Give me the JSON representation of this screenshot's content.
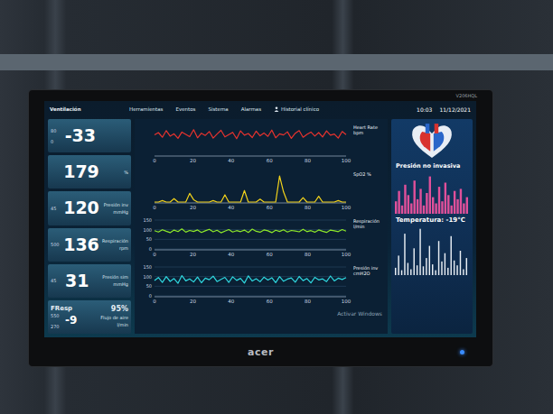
{
  "monitor": {
    "brand": "acer",
    "model": "V206HQL"
  },
  "top_bar": {
    "title": "Ventilación",
    "tabs": [
      {
        "label": "Herramientas",
        "selected": false
      },
      {
        "label": "Eventos",
        "selected": false
      },
      {
        "label": "Sistema",
        "selected": false
      },
      {
        "label": "Alarmas",
        "selected": false
      },
      {
        "label": "Historial clínico",
        "selected": false
      }
    ],
    "time": "10:03",
    "date": "11/12/2021"
  },
  "vitals": [
    {
      "kind": "single",
      "value": "-33",
      "scale_top": "80",
      "scale_bottom": "0"
    },
    {
      "kind": "single",
      "value": "179",
      "unit": "%"
    },
    {
      "kind": "single",
      "label": "Presión inv",
      "value": "120",
      "unit": "mmHg",
      "scale_top": "45"
    },
    {
      "kind": "single",
      "label": "Respiración",
      "value": "136",
      "unit": "rpm",
      "scale_top": "500"
    },
    {
      "kind": "single",
      "label": "Presión sim",
      "value": "31",
      "unit": "mmHg",
      "scale_top": "45"
    },
    {
      "kind": "dual",
      "label": "FResp",
      "value": "95%",
      "scale_top": "550",
      "scale_bottom": "270",
      "value2": "-9",
      "label2": "Flujo de aire",
      "unit": "l/min"
    }
  ],
  "charts": [
    {
      "label": "Heart Rate bpm",
      "color": "#e8332e",
      "x_ticks": [
        "0",
        "20",
        "40",
        "60",
        "80",
        "100"
      ],
      "values": [
        70,
        78,
        62,
        85,
        66,
        74,
        58,
        80,
        72,
        64,
        88,
        60,
        76,
        68,
        82,
        59,
        73,
        86,
        63,
        71,
        79,
        57,
        84,
        69,
        75,
        61,
        83,
        67,
        77,
        65,
        87,
        60,
        74,
        70,
        81,
        58,
        76,
        85,
        62,
        72,
        80,
        66,
        78,
        63,
        84,
        69,
        73,
        59,
        82,
        71
      ]
    },
    {
      "label": "SpO2 %",
      "color": "#f2d21b",
      "x_ticks": [
        "0",
        "20",
        "40",
        "60",
        "80",
        "100"
      ],
      "values": [
        0,
        0,
        5,
        0,
        0,
        12,
        0,
        0,
        0,
        30,
        8,
        0,
        0,
        0,
        0,
        5,
        0,
        0,
        25,
        0,
        0,
        0,
        0,
        40,
        0,
        0,
        0,
        10,
        0,
        0,
        0,
        0,
        90,
        35,
        0,
        0,
        0,
        0,
        15,
        0,
        0,
        0,
        20,
        0,
        0,
        0,
        0,
        5,
        0,
        0
      ]
    },
    {
      "label": "Respiración l/min",
      "color": "#8ee82a",
      "y_ticks": [
        "150",
        "100",
        "50",
        "0"
      ],
      "x_ticks": [
        "0",
        "20",
        "40",
        "60",
        "80",
        "100"
      ],
      "values": [
        95,
        88,
        100,
        92,
        85,
        98,
        90,
        104,
        87,
        96,
        91,
        99,
        86,
        94,
        102,
        89,
        97,
        84,
        93,
        101,
        88,
        95,
        90,
        98,
        86,
        103,
        92,
        87,
        99,
        94,
        85,
        97,
        91,
        100,
        88,
        96,
        93,
        89,
        102,
        90,
        95,
        87,
        99,
        92,
        86,
        98,
        94,
        90,
        101,
        93
      ]
    },
    {
      "label": "Presión inv cmH2O",
      "color": "#2fd8e0",
      "y_ticks": [
        "150",
        "100",
        "50",
        "0"
      ],
      "x_ticks": [
        "0",
        "20",
        "40",
        "60",
        "80",
        "100"
      ],
      "values": [
        80,
        95,
        70,
        100,
        75,
        90,
        65,
        105,
        78,
        88,
        72,
        98,
        68,
        92,
        84,
        102,
        74,
        86,
        96,
        70,
        99,
        80,
        91,
        66,
        104,
        77,
        89,
        73,
        97,
        82,
        94,
        69,
        100,
        76,
        87,
        93,
        71,
        101,
        79,
        90,
        67,
        96,
        83,
        88,
        74,
        103,
        78,
        92,
        85,
        95
      ]
    }
  ],
  "watermark": "Activar Windows",
  "side_panel": {
    "pressure": {
      "title": "Presión no invasiva",
      "color": "#e0509a",
      "values": [
        30,
        55,
        20,
        70,
        45,
        25,
        80,
        35,
        60,
        20,
        50,
        90,
        40,
        25,
        65,
        30,
        75,
        45,
        20,
        55,
        35,
        60,
        25,
        40
      ]
    },
    "temperature": {
      "title": "Temperatura: -19°C",
      "color": "#e8eef4",
      "values": [
        15,
        40,
        10,
        85,
        25,
        12,
        55,
        20,
        95,
        18,
        35,
        60,
        22,
        10,
        70,
        28,
        45,
        15,
        80,
        30,
        20,
        50,
        12,
        35
      ]
    }
  }
}
